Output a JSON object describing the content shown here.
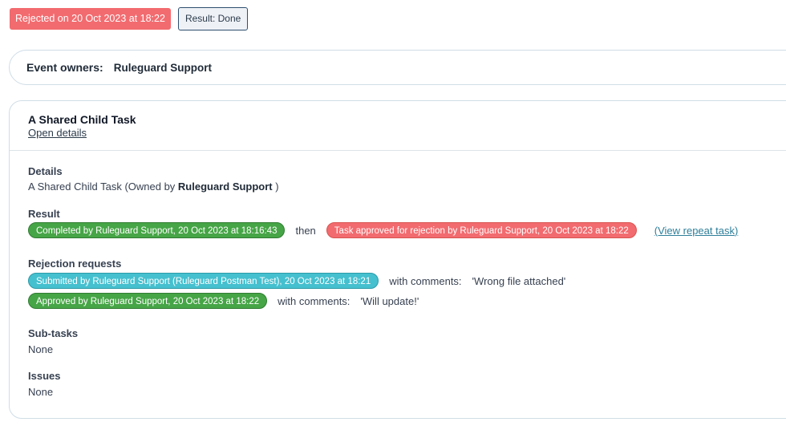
{
  "status": {
    "rejected_label": "Rejected on 20 Oct 2023 at 18:22",
    "result_label": "Result: Done"
  },
  "owners": {
    "label": "Event owners:",
    "value": "Ruleguard Support"
  },
  "task": {
    "title": "A Shared Child Task",
    "open_details": "Open details",
    "details": {
      "label": "Details",
      "text_before": "A Shared Child Task (Owned by ",
      "owner": "Ruleguard Support",
      "text_after": " )"
    },
    "result": {
      "label": "Result",
      "completed": "Completed by Ruleguard Support, 20 Oct 2023 at 18:16:43",
      "then": "then",
      "approved_rejection": "Task approved for rejection by Ruleguard Support, 20 Oct 2023 at 18:22",
      "view_repeat": "(View repeat task)"
    },
    "rejection": {
      "label": "Rejection requests",
      "requests": [
        {
          "badge": "Submitted by Ruleguard Support (Ruleguard Postman Test), 20 Oct 2023 at 18:21",
          "with": "with comments:",
          "comment": "'Wrong file attached'"
        },
        {
          "badge": "Approved by Ruleguard Support, 20 Oct 2023 at 18:22",
          "with": "with comments:",
          "comment": "'Will update!'"
        }
      ]
    },
    "subtasks": {
      "label": "Sub-tasks",
      "value": "None"
    },
    "issues": {
      "label": "Issues",
      "value": "None"
    }
  },
  "colors": {
    "danger": "#f26b6f",
    "success": "#46a546",
    "info": "#45c0cf"
  }
}
